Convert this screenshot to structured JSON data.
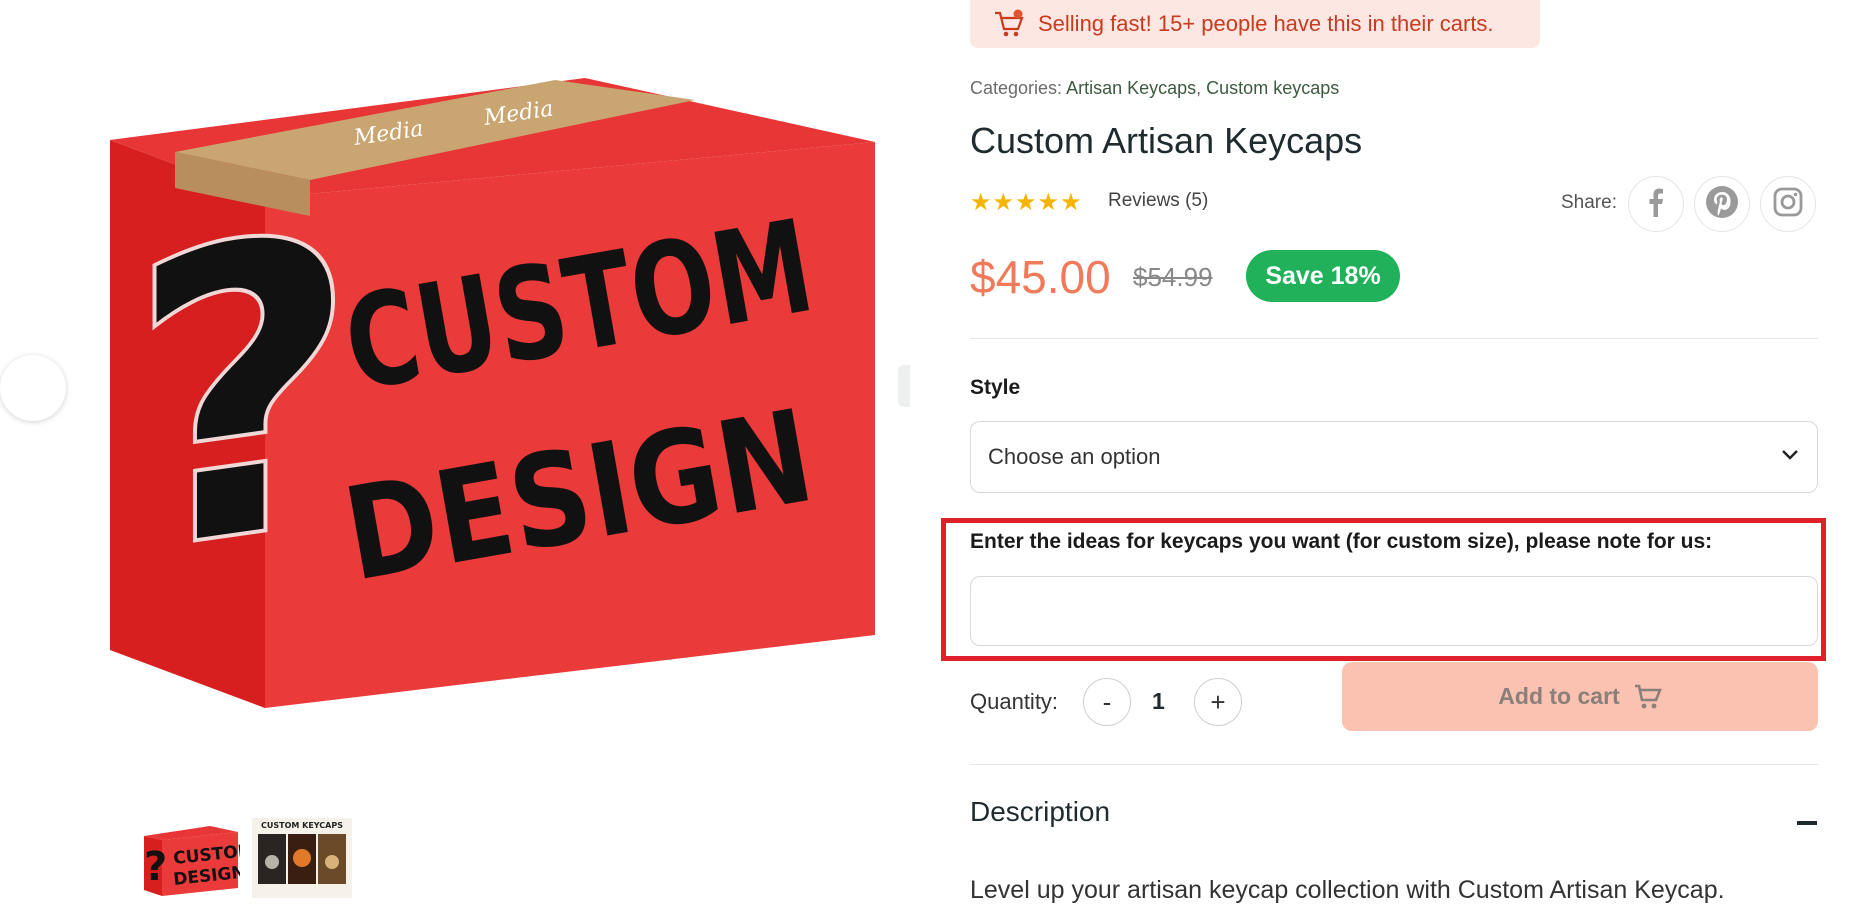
{
  "gallery": {
    "main_image": {
      "alt": "Custom design red box",
      "text_lines": [
        "CUSTOM",
        "DESIGN"
      ],
      "symbol": "?",
      "tape_text": "Media"
    },
    "thumbnails": [
      {
        "caption_lines": [
          "CUSTOM",
          "DESIGN"
        ]
      },
      {
        "caption": "CUSTOM KEYCAPS"
      }
    ]
  },
  "alert": {
    "icon": "shopping-cart-icon",
    "text": "Selling fast!  15+ people have this in their carts."
  },
  "product": {
    "categories_label": "Categories:",
    "categories": [
      "Artisan Keycaps",
      "Custom keycaps"
    ],
    "category_separator": ",",
    "title": "Custom Artisan Keycaps",
    "rating": 5,
    "stars": "★★★★★",
    "reviews_label": "Reviews (5)",
    "price": "$45.00",
    "old_price": "$54.99",
    "save_badge": "Save 18%"
  },
  "share": {
    "label": "Share:",
    "icons": [
      "facebook-icon",
      "pinterest-icon",
      "instagram-icon"
    ]
  },
  "form": {
    "style_label": "Style",
    "style_select_value": "Choose an option",
    "note_label": "Enter the ideas for keycaps you want (for custom size), please note for us:",
    "note_value": "",
    "quantity_label": "Quantity:",
    "quantity_minus": "-",
    "quantity_value": "1",
    "quantity_plus": "+",
    "add_to_cart_label": "Add to cart"
  },
  "description": {
    "heading": "Description",
    "text": "Level up your artisan keycap collection with Custom  Artisan Keycap."
  },
  "colors": {
    "accent_price": "#f07a5a",
    "save_badge": "#20b15a",
    "alert_bg": "#fde7e3",
    "alert_text": "#c93a1f",
    "highlight_border": "#e0202a",
    "cart_button": "#fbc1b1",
    "stars": "#f5b400"
  }
}
